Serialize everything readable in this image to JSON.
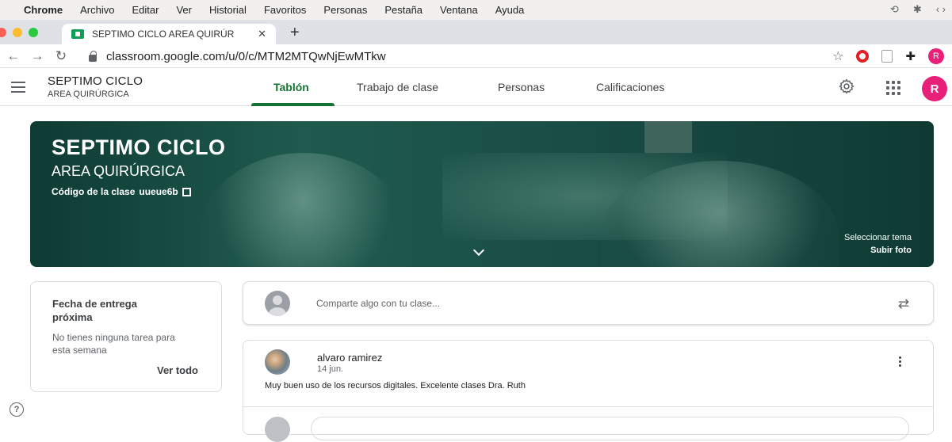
{
  "menubar": {
    "items": [
      "Chrome",
      "Archivo",
      "Editar",
      "Ver",
      "Historial",
      "Favoritos",
      "Personas",
      "Pestaña",
      "Ventana",
      "Ayuda"
    ]
  },
  "browser": {
    "tab_title": "SEPTIMO CICLO AREA QUIRÚR",
    "url": "classroom.google.com/u/0/c/MTM2MTQwNjEwMTkw",
    "profile_initial": "R",
    "traffic_colors": [
      "#fe5f57",
      "#febc2e",
      "#28c840"
    ]
  },
  "classroom": {
    "class_name": "SEPTIMO CICLO",
    "section": "AREA QUIRÚRGICA",
    "tabs": [
      "Tablón",
      "Trabajo de clase",
      "Personas",
      "Calificaciones"
    ],
    "active_tab": "Tablón",
    "profile_initial": "R",
    "accent": "#137333"
  },
  "banner": {
    "title": "SEPTIMO CICLO",
    "subtitle": "AREA QUIRÚRGICA",
    "class_code_label": "Código de la clase",
    "class_code": "uueue6b",
    "select_theme": "Seleccionar tema",
    "upload_photo": "Subir foto"
  },
  "upcoming": {
    "title": "Fecha de entrega próxima",
    "empty_text": "No tienes ninguna tarea para esta semana",
    "view_all": "Ver todo"
  },
  "share": {
    "placeholder": "Comparte algo con tu clase..."
  },
  "post": {
    "author": "alvaro ramirez",
    "date": "14 jun.",
    "body": "Muy buen uso de los recursos digitales. Excelente clases  Dra. Ruth"
  }
}
